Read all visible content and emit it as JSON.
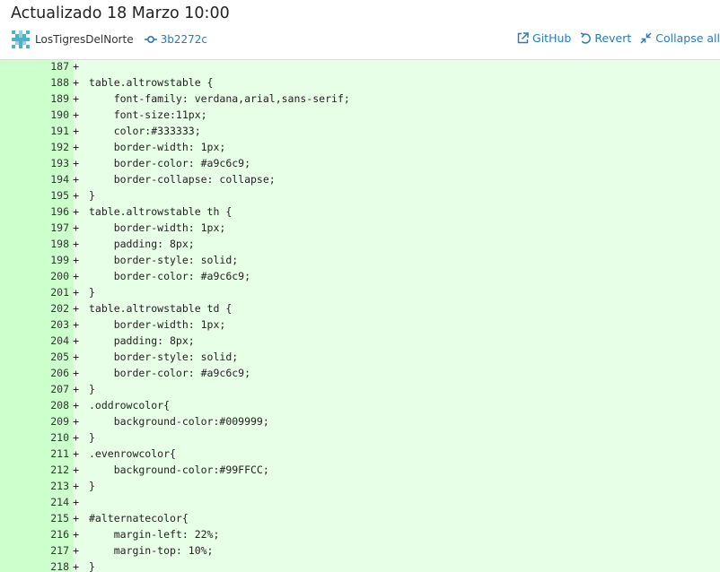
{
  "header": {
    "title": "Actualizado 18 Marzo 10:00",
    "author": "LosTigresDelNorte",
    "commit_hash": "3b2272c",
    "actions": [
      {
        "label": "GitHub",
        "icon": "external-link-icon"
      },
      {
        "label": "Revert",
        "icon": "revert-icon"
      },
      {
        "label": "Collapse all",
        "icon": "collapse-icon"
      }
    ]
  },
  "colors": {
    "added_background": "#e6ffe6",
    "added_gutter": "#ccffcc",
    "link": "#2a7ab8"
  },
  "diff": {
    "lines": [
      {
        "n": "187",
        "sign": "+",
        "text": ""
      },
      {
        "n": "188",
        "sign": "+",
        "text": "table.altrowstable {"
      },
      {
        "n": "189",
        "sign": "+",
        "text": "    font-family: verdana,arial,sans-serif;"
      },
      {
        "n": "190",
        "sign": "+",
        "text": "    font-size:11px;"
      },
      {
        "n": "191",
        "sign": "+",
        "text": "    color:#333333;"
      },
      {
        "n": "192",
        "sign": "+",
        "text": "    border-width: 1px;"
      },
      {
        "n": "193",
        "sign": "+",
        "text": "    border-color: #a9c6c9;"
      },
      {
        "n": "194",
        "sign": "+",
        "text": "    border-collapse: collapse;"
      },
      {
        "n": "195",
        "sign": "+",
        "text": "}"
      },
      {
        "n": "196",
        "sign": "+",
        "text": "table.altrowstable th {"
      },
      {
        "n": "197",
        "sign": "+",
        "text": "    border-width: 1px;"
      },
      {
        "n": "198",
        "sign": "+",
        "text": "    padding: 8px;"
      },
      {
        "n": "199",
        "sign": "+",
        "text": "    border-style: solid;"
      },
      {
        "n": "200",
        "sign": "+",
        "text": "    border-color: #a9c6c9;"
      },
      {
        "n": "201",
        "sign": "+",
        "text": "}"
      },
      {
        "n": "202",
        "sign": "+",
        "text": "table.altrowstable td {"
      },
      {
        "n": "203",
        "sign": "+",
        "text": "    border-width: 1px;"
      },
      {
        "n": "204",
        "sign": "+",
        "text": "    padding: 8px;"
      },
      {
        "n": "205",
        "sign": "+",
        "text": "    border-style: solid;"
      },
      {
        "n": "206",
        "sign": "+",
        "text": "    border-color: #a9c6c9;"
      },
      {
        "n": "207",
        "sign": "+",
        "text": "}"
      },
      {
        "n": "208",
        "sign": "+",
        "text": ".oddrowcolor{"
      },
      {
        "n": "209",
        "sign": "+",
        "text": "    background-color:#009999;"
      },
      {
        "n": "210",
        "sign": "+",
        "text": "}"
      },
      {
        "n": "211",
        "sign": "+",
        "text": ".evenrowcolor{"
      },
      {
        "n": "212",
        "sign": "+",
        "text": "    background-color:#99FFCC;"
      },
      {
        "n": "213",
        "sign": "+",
        "text": "}"
      },
      {
        "n": "214",
        "sign": "+",
        "text": ""
      },
      {
        "n": "215",
        "sign": "+",
        "text": "#alternatecolor{"
      },
      {
        "n": "216",
        "sign": "+",
        "text": "    margin-left: 22%;"
      },
      {
        "n": "217",
        "sign": "+",
        "text": "    margin-top: 10%;"
      },
      {
        "n": "218",
        "sign": "+",
        "text": "}"
      }
    ]
  }
}
